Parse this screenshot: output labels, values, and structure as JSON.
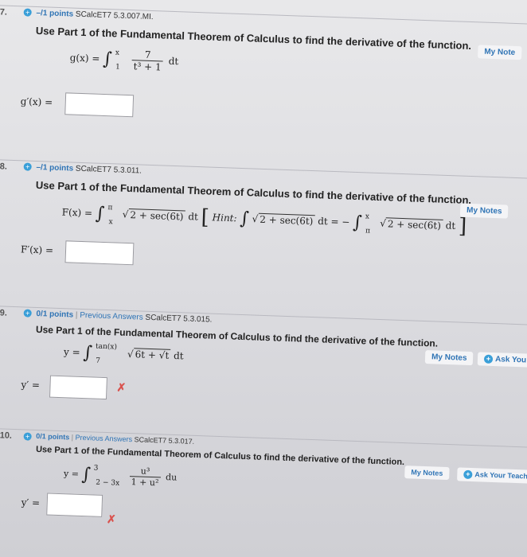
{
  "questions": [
    {
      "number": "7.",
      "points": "–/1 points",
      "previous_answers": "",
      "code": "SCalcET7 5.3.007.MI.",
      "prompt": "Use Part 1 of the Fundamental Theorem of Calculus to find the derivative of the function.",
      "function_lhs": "g(x) =",
      "upper": "x",
      "lower": "1",
      "numerator": "7",
      "denominator": "t³ + 1",
      "differential": "dt",
      "answer_label": "g′(x) =",
      "notes_label": "My Note"
    },
    {
      "number": "8.",
      "points": "–/1 points",
      "previous_answers": "",
      "code": "SCalcET7 5.3.011.",
      "prompt": "Use Part 1 of the Fundamental Theorem of Calculus to find the derivative of the function.",
      "function_lhs": "F(x) =",
      "upper": "π",
      "lower": "x",
      "integrand": "2 + sec(6t)",
      "differential": "dt",
      "hint_label": "Hint:",
      "hint_mid": "dt = −",
      "hint_upper2": "x",
      "hint_lower2": "π",
      "answer_label": "F′(x) =",
      "notes_label": "My Notes"
    },
    {
      "number": "9.",
      "points": "0/1 points",
      "previous_answers": "Previous Answers",
      "code": "SCalcET7 5.3.015.",
      "prompt": "Use Part 1 of the Fundamental Theorem of Calculus to find the derivative of the function.",
      "function_lhs": "y =",
      "upper": "tan(x)",
      "lower": "7",
      "integrand": "6t + √t",
      "differential": "dt",
      "answer_label": "y′ =",
      "notes_label": "My Notes",
      "ask_label": "Ask You",
      "mark": "✗"
    },
    {
      "number": "10.",
      "points": "0/1 points",
      "previous_answers": "Previous Answers",
      "code": "SCalcET7 5.3.017.",
      "prompt": "Use Part 1 of the Fundamental Theorem of Calculus to find the derivative of the function.",
      "function_lhs": "y =",
      "upper": "3",
      "lower": "2 − 3x",
      "numerator": "u³",
      "denominator": "1 + u²",
      "differential": "du",
      "answer_label": "y′ =",
      "notes_label": "My Notes",
      "ask_label": "Ask Your Teache",
      "mark": "✗"
    }
  ]
}
